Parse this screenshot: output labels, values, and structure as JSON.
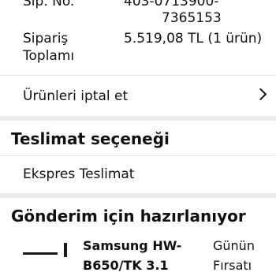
{
  "order": {
    "order_no_label": "Sip. No.",
    "order_no_line1": "403-0713900-",
    "order_no_line2": "7365153",
    "total_label_line1": "Sipariş",
    "total_label_line2": "Toplamı",
    "total_value": "5.519,08 TL (1 ürün)"
  },
  "cancel": {
    "label": "Ürünleri iptal et"
  },
  "delivery": {
    "title": "Teslimat seçeneği",
    "option": "Ekspres Teslimat"
  },
  "shipment": {
    "title": "Gönderim için hazırlanıyor",
    "product_line1": "Samsung HW-",
    "product_line2": "B650/TK 3.1",
    "deal_line1": "Günün",
    "deal_line2": "Fırsatı"
  }
}
